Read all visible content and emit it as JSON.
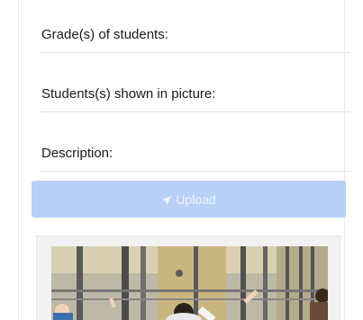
{
  "form": {
    "grade_label": "Grade(s) of students:",
    "students_label": "Students(s) shown in picture:",
    "description_label": "Description:",
    "upload_label": "Upload"
  },
  "icons": {
    "upload_icon": "send-arrow-icon"
  },
  "colors": {
    "upload_button_bg": "#b7d0f6",
    "upload_button_text": "#eef4ff"
  }
}
